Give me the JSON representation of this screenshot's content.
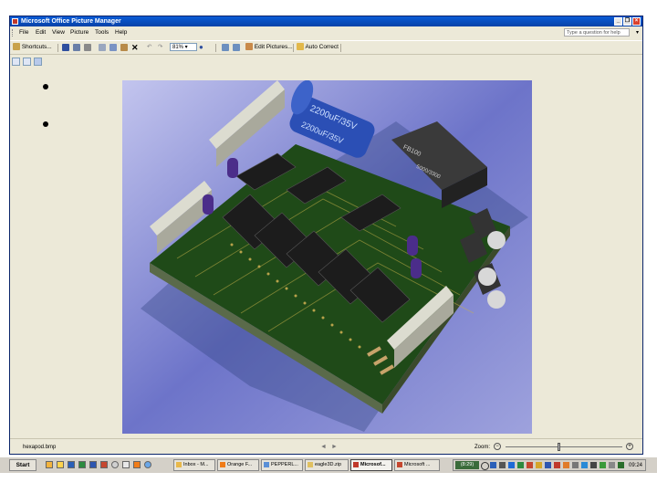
{
  "window": {
    "title": "Microsoft Office Picture Manager",
    "controls": [
      "_",
      "×",
      "×"
    ]
  },
  "menubar": {
    "items": [
      "File",
      "Edit",
      "View",
      "Picture",
      "Tools",
      "Help"
    ],
    "ask_placeholder": "Type a question for help"
  },
  "toolbar": {
    "shortcuts_label": "Shortcuts...",
    "zoom_value": "81%",
    "edit_pictures_label": "Edit Pictures...",
    "auto_correct_label": "Auto Correct"
  },
  "image": {
    "description_icon": "pcb-board-3d-render",
    "chip_texts": [
      "2200uF/35V",
      "2200uF/35V",
      "FB100",
      "5000/3300"
    ]
  },
  "statusbar": {
    "filename": "hexapod.bmp",
    "zoom_label": "Zoom:",
    "zoom_level": 0.45
  },
  "taskbar": {
    "start_label": "Start",
    "tasks": [
      "Inbox - M...",
      "Orange F...",
      "PEPPERL...",
      "eagle3D.zip",
      "Microsof...",
      "Microsoft ..."
    ],
    "active_task": 4,
    "tray_badge": "(8:29)",
    "clock": "09:24"
  },
  "colors": {
    "titlebar": "#0a5bd6",
    "window_face": "#ece9d8",
    "photo_bg": "#7d82d0",
    "pcb_green": "#2f5b1c"
  }
}
